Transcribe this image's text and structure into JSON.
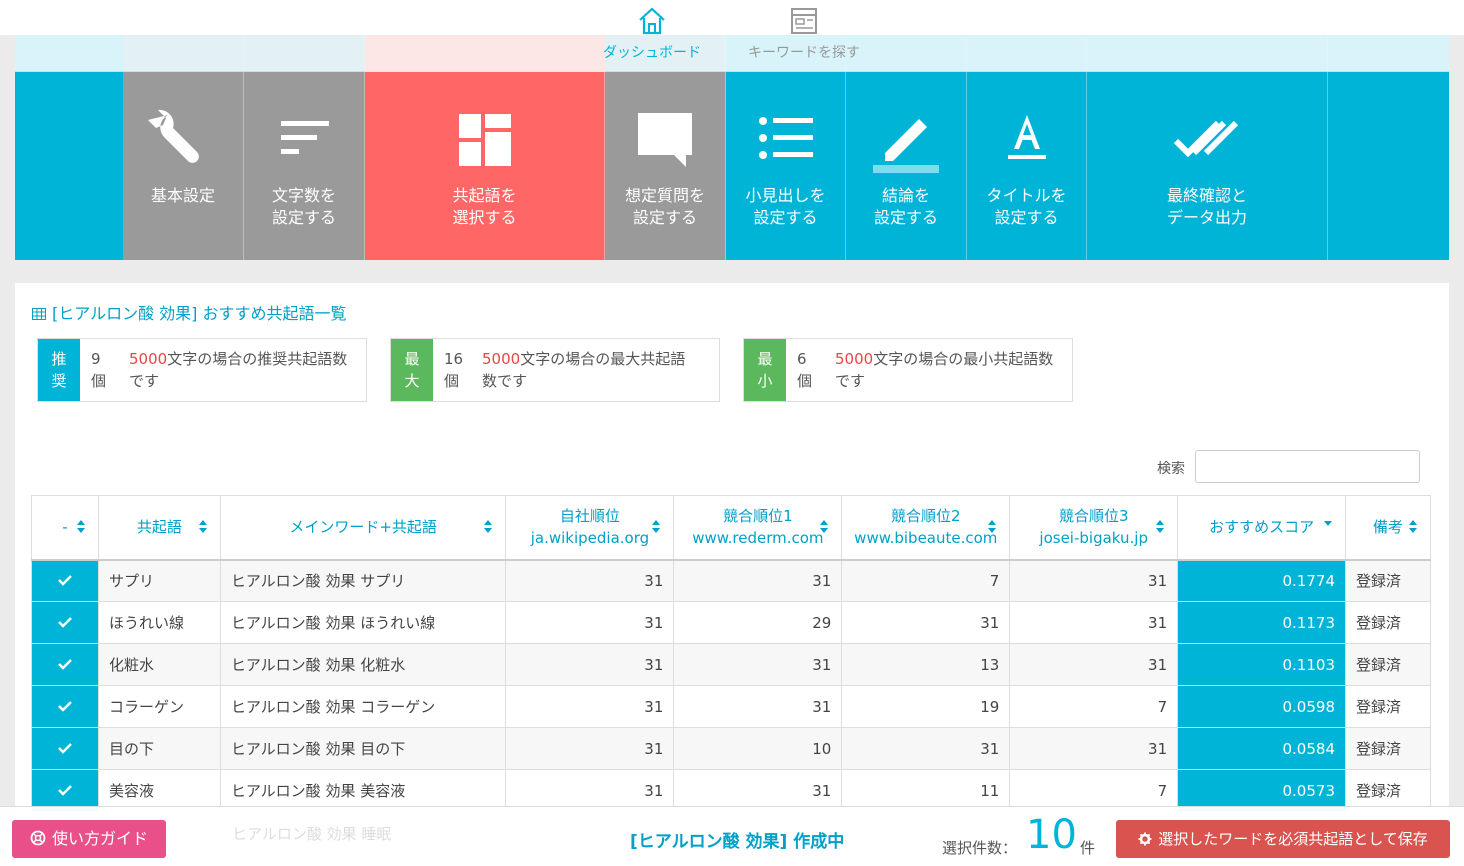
{
  "nav": {
    "dashboard_label": "ダッシュボード",
    "keyword_label": "キーワードを探す"
  },
  "steps": [
    {
      "label1": "基本設定",
      "label2": "",
      "state": "done"
    },
    {
      "label1": "文字数を",
      "label2": "設定する",
      "state": "done"
    },
    {
      "label1": "共起語を",
      "label2": "選択する",
      "state": "current"
    },
    {
      "label1": "想定質問を",
      "label2": "設定する",
      "state": "done"
    },
    {
      "label1": "小見出しを",
      "label2": "設定する",
      "state": "todo"
    },
    {
      "label1": "結論を",
      "label2": "設定する",
      "state": "todo"
    },
    {
      "label1": "タイトルを",
      "label2": "設定する",
      "state": "todo"
    },
    {
      "label1": "最終確認と",
      "label2": "データ出力",
      "state": "todo"
    }
  ],
  "panel": {
    "title": "[ヒアルロン酸 効果] おすすめ共起語一覧"
  },
  "info": [
    {
      "tag1": "推",
      "tag2": "奨",
      "num1": "9",
      "num2": "個",
      "highlight": "5000",
      "desc1": "文字の場合の推奨共起語数",
      "desc2": "です"
    },
    {
      "tag1": "最",
      "tag2": "大",
      "num1": "16",
      "num2": "個",
      "highlight": "5000",
      "desc1": "文字の場合の最大共起語",
      "desc2": "数です"
    },
    {
      "tag1": "最",
      "tag2": "小",
      "num1": "6",
      "num2": "個",
      "highlight": "5000",
      "desc1": "文字の場合の最小共起語数",
      "desc2": "です"
    }
  ],
  "search": {
    "label": "検索",
    "value": ""
  },
  "table": {
    "headers": {
      "check": "-",
      "word": "共起語",
      "mainword": "メインワード+共起語",
      "own_rank": "自社順位",
      "own_site": "ja.wikipedia.org",
      "comp1": "競合順位1",
      "comp1_site": "www.rederm.com",
      "comp2": "競合順位2",
      "comp2_site": "www.bibeaute.com",
      "comp3": "競合順位3",
      "comp3_site": "josei-bigaku.jp",
      "score": "おすすめスコア",
      "note": "備考"
    },
    "rows": [
      {
        "word": "サプリ",
        "main": "ヒアルロン酸 効果 サプリ",
        "own": "31",
        "c1": "31",
        "c2": "7",
        "c3": "31",
        "score": "0.1774",
        "note": "登録済"
      },
      {
        "word": "ほうれい線",
        "main": "ヒアルロン酸 効果 ほうれい線",
        "own": "31",
        "c1": "29",
        "c2": "31",
        "c3": "31",
        "score": "0.1173",
        "note": "登録済"
      },
      {
        "word": "化粧水",
        "main": "ヒアルロン酸 効果 化粧水",
        "own": "31",
        "c1": "31",
        "c2": "13",
        "c3": "31",
        "score": "0.1103",
        "note": "登録済"
      },
      {
        "word": "コラーゲン",
        "main": "ヒアルロン酸 効果 コラーゲン",
        "own": "31",
        "c1": "31",
        "c2": "19",
        "c3": "7",
        "score": "0.0598",
        "note": "登録済"
      },
      {
        "word": "目の下",
        "main": "ヒアルロン酸 効果 目の下",
        "own": "31",
        "c1": "10",
        "c2": "31",
        "c3": "31",
        "score": "0.0584",
        "note": "登録済"
      },
      {
        "word": "美容液",
        "main": "ヒアルロン酸 効果 美容液",
        "own": "31",
        "c1": "31",
        "c2": "11",
        "c3": "7",
        "score": "0.0573",
        "note": "登録済"
      }
    ]
  },
  "bottom": {
    "guide": "使い方ガイド",
    "status": "[ヒアルロン酸 効果] 作成中",
    "count_label": "選択件数：",
    "count": "10",
    "count_unit": "件",
    "save": "選択したワードを必須共起語として保存",
    "ghost_text": "ヒアルロン酸 効果 睡眠"
  },
  "colors": {
    "accent": "#00b4d8",
    "current_step": "#ff6666",
    "done_step": "#9a9a9a",
    "guide": "#e9508a",
    "save": "#d9534f"
  }
}
